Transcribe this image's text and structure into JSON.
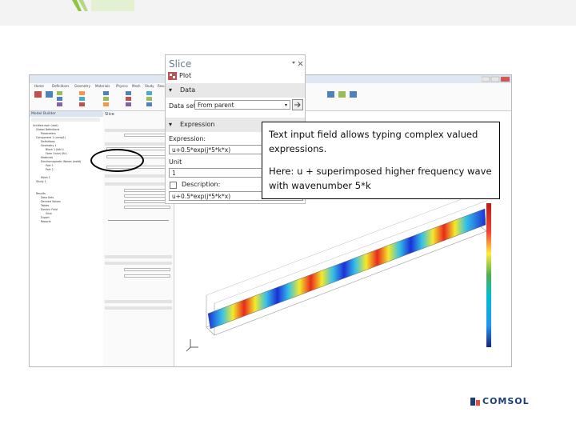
{
  "slide": {
    "footer_logo_text": "COMSOL",
    "brand_color": "#1c3e78"
  },
  "app": {
    "ribbon_tabs": [
      "Home",
      "Definitions",
      "Geometry",
      "Materials",
      "Physics",
      "Mesh",
      "Study",
      "Results"
    ],
    "model_builder_title": "Model Builder",
    "settings_title": "Slice",
    "tree_items": [
      "Untitled.mph (root)",
      "Global Definitions",
      "Parameters",
      "Component 1 (comp1)",
      "Definitions",
      "Geometry 1",
      "Block 1 (blk1)",
      "Form Union (fin)",
      "Materials",
      "Electromagnetic Waves (ewfd)",
      "Port 1",
      "Port 2",
      "Mesh 1",
      "Study 1",
      "Results",
      "Data Sets",
      "Derived Values",
      "Tables",
      "Electric Field",
      "Slice",
      "Export",
      "Reports"
    ]
  },
  "zoom_panel": {
    "title": "Slice",
    "plot_button": "Plot",
    "data_section": "Data",
    "data_set_label": "Data set:",
    "data_set_value": "From parent",
    "expression_section": "Expression",
    "expression_label": "Expression:",
    "expression_value": "u+0.5*exp(j*5*k*x)",
    "unit_label": "Unit",
    "unit_value": "1",
    "description_label": "Description:",
    "description_value": "u+0.5*exp(j*5*k*x)"
  },
  "callout": {
    "line1": "Text input field allows typing complex valued expressions.",
    "line2": "Here: u + superimposed higher frequency wave with wavenumber 5*k"
  }
}
